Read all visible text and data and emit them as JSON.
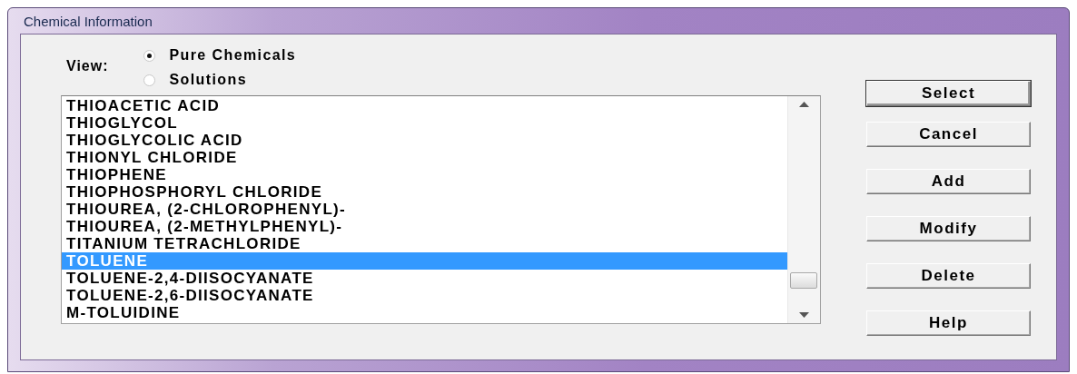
{
  "window": {
    "title": "Chemical Information"
  },
  "view": {
    "label": "View:",
    "options": [
      {
        "label": "Pure Chemicals",
        "selected": true
      },
      {
        "label": "Solutions",
        "selected": false
      }
    ]
  },
  "list": {
    "items": [
      {
        "label": "THIOACETIC ACID",
        "selected": false
      },
      {
        "label": "THIOGLYCOL",
        "selected": false
      },
      {
        "label": "THIOGLYCOLIC ACID",
        "selected": false
      },
      {
        "label": "THIONYL CHLORIDE",
        "selected": false
      },
      {
        "label": "THIOPHENE",
        "selected": false
      },
      {
        "label": "THIOPHOSPHORYL CHLORIDE",
        "selected": false
      },
      {
        "label": "THIOUREA, (2-CHLOROPHENYL)-",
        "selected": false
      },
      {
        "label": "THIOUREA, (2-METHYLPHENYL)-",
        "selected": false
      },
      {
        "label": "TITANIUM TETRACHLORIDE",
        "selected": false
      },
      {
        "label": "TOLUENE",
        "selected": true
      },
      {
        "label": "TOLUENE-2,4-DIISOCYANATE",
        "selected": false
      },
      {
        "label": "TOLUENE-2,6-DIISOCYANATE",
        "selected": false
      },
      {
        "label": "M-TOLUIDINE",
        "selected": false
      }
    ]
  },
  "buttons": [
    {
      "label": "Select",
      "default": true
    },
    {
      "label": "Cancel",
      "default": false
    },
    {
      "label": "Add",
      "default": false
    },
    {
      "label": "Modify",
      "default": false
    },
    {
      "label": "Delete",
      "default": false
    },
    {
      "label": "Help",
      "default": false
    }
  ]
}
